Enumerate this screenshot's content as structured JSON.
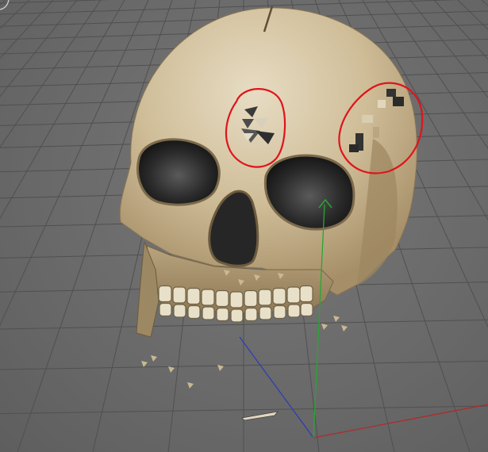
{
  "viewport": {
    "description": "",
    "colors": {
      "background": "#6b6b6b",
      "grid": "#4f4f4f",
      "axis_x": "#b02a2a",
      "axis_y": "#27a632",
      "axis_z": "#2d3fb0",
      "annotation": "#e0141b",
      "bone": "#d7c7a4"
    },
    "icons": {
      "corner_glyph": "viewport-corner-icon",
      "move_gizmo": "arrow-up-icon"
    }
  }
}
